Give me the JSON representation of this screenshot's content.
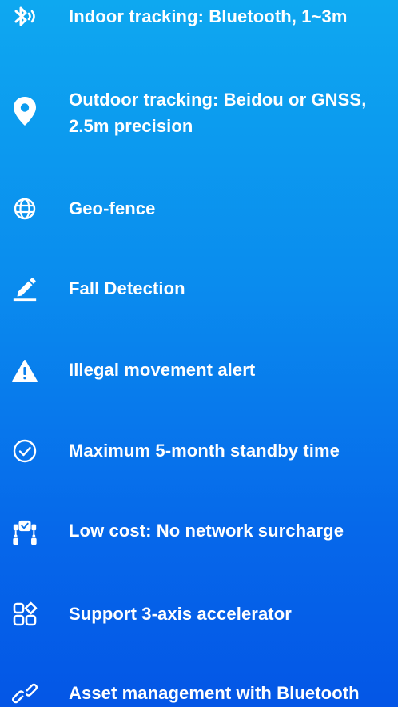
{
  "colors": {
    "background_top": "#0ea8f0",
    "background_bottom": "#0456e6",
    "text": "#ffffff",
    "icon": "#ffffff"
  },
  "features": [
    {
      "icon": "bluetooth-icon",
      "label": "Indoor tracking: Bluetooth, 1~3m"
    },
    {
      "icon": "location-pin-icon",
      "label": "Outdoor tracking: Beidou or GNSS, 2.5m precision"
    },
    {
      "icon": "globe-icon",
      "label": "Geo-fence"
    },
    {
      "icon": "pencil-icon",
      "label": "Fall Detection"
    },
    {
      "icon": "warning-icon",
      "label": "Illegal movement alert"
    },
    {
      "icon": "check-circle-icon",
      "label": "Maximum 5-month standby time"
    },
    {
      "icon": "network-nodes-icon",
      "label": "Low cost: No network surcharge"
    },
    {
      "icon": "apps-grid-icon",
      "label": "Support 3-axis accelerator"
    },
    {
      "icon": "link-icon",
      "label": "Asset management with Bluetooth"
    }
  ]
}
